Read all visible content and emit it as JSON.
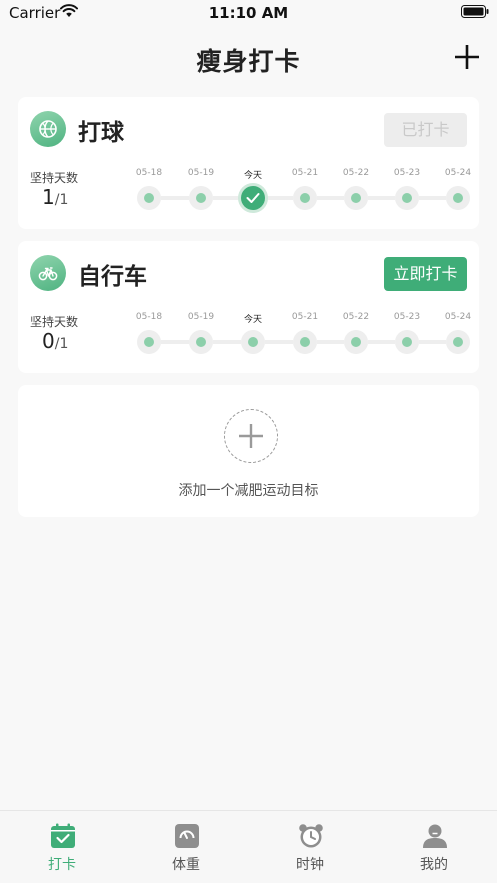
{
  "status_bar": {
    "carrier": "Carrier",
    "time": "11:10 AM"
  },
  "header": {
    "title": "瘦身打卡"
  },
  "habits": [
    {
      "name": "打球",
      "icon": "basketball-icon",
      "button_label": "已打卡",
      "button_state": "done",
      "streak_label": "坚持天数",
      "streak_count": "1",
      "streak_total": "/1",
      "days": [
        {
          "label": "05-18",
          "today": false,
          "checked": false
        },
        {
          "label": "05-19",
          "today": false,
          "checked": false
        },
        {
          "label": "今天",
          "today": true,
          "checked": true
        },
        {
          "label": "05-21",
          "today": false,
          "checked": false
        },
        {
          "label": "05-22",
          "today": false,
          "checked": false
        },
        {
          "label": "05-23",
          "today": false,
          "checked": false
        },
        {
          "label": "05-24",
          "today": false,
          "checked": false
        }
      ]
    },
    {
      "name": "自行车",
      "icon": "bicycle-icon",
      "button_label": "立即打卡",
      "button_state": "active",
      "streak_label": "坚持天数",
      "streak_count": "0",
      "streak_total": "/1",
      "days": [
        {
          "label": "05-18",
          "today": false,
          "checked": false
        },
        {
          "label": "05-19",
          "today": false,
          "checked": false
        },
        {
          "label": "今天",
          "today": true,
          "checked": false
        },
        {
          "label": "05-21",
          "today": false,
          "checked": false
        },
        {
          "label": "05-22",
          "today": false,
          "checked": false
        },
        {
          "label": "05-23",
          "today": false,
          "checked": false
        },
        {
          "label": "05-24",
          "today": false,
          "checked": false
        }
      ]
    }
  ],
  "add_goal": {
    "label": "添加一个减肥运动目标"
  },
  "tabs": [
    {
      "label": "打卡",
      "icon": "calendar-check-icon",
      "active": true
    },
    {
      "label": "体重",
      "icon": "scale-icon",
      "active": false
    },
    {
      "label": "时钟",
      "icon": "alarm-clock-icon",
      "active": false
    },
    {
      "label": "我的",
      "icon": "user-icon",
      "active": false
    }
  ],
  "colors": {
    "accent": "#3fad78",
    "dot": "#8ccfaa",
    "track": "#eeeeee",
    "disabled_bg": "#ededed"
  }
}
